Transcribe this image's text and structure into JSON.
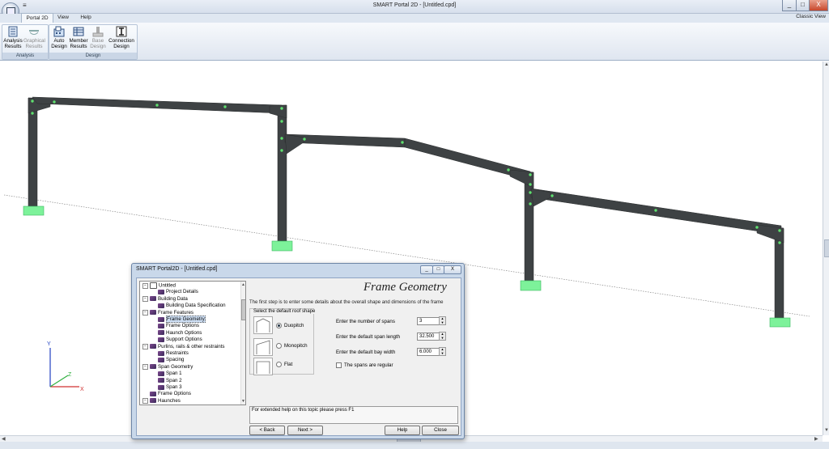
{
  "window": {
    "title": "SMART Portal 2D - [Untitled.cpd]",
    "min": "_",
    "max": "□",
    "close": "X",
    "qa": "≡"
  },
  "menu": {
    "tabs": [
      "Portal 2D",
      "View",
      "Help"
    ],
    "classic_view": "Classic View"
  },
  "ribbon": {
    "groups": [
      {
        "label": "Analysis",
        "buttons": [
          {
            "line1": "Analysis",
            "line2": "Results",
            "icon": "analysis-results-icon",
            "enabled": true
          },
          {
            "line1": "Graphical",
            "line2": "Results",
            "icon": "graphical-results-icon",
            "enabled": false
          }
        ]
      },
      {
        "label": "Design",
        "buttons": [
          {
            "line1": "Auto",
            "line2": "Design",
            "icon": "auto-design-icon",
            "enabled": true
          },
          {
            "line1": "Member",
            "line2": "Results",
            "icon": "member-results-icon",
            "enabled": true
          },
          {
            "line1": "Base",
            "line2": "Design",
            "icon": "base-design-icon",
            "enabled": false
          },
          {
            "line1": "Connection",
            "line2": "Design",
            "icon": "connection-design-icon",
            "enabled": true
          }
        ]
      }
    ]
  },
  "axes": {
    "y": "Y",
    "z": "Z",
    "x": "X"
  },
  "colors": {
    "member": "#3e4244",
    "base": "#7df29a",
    "node": "#5fe06f",
    "accent": "#c9d8ea"
  },
  "dialog": {
    "title": "SMART Portal2D - [Untitled.cpd]",
    "heading": "Frame Geometry",
    "intro": "The first step is to enter some details about the overall shape and dimensions of the frame",
    "roof_group": "Select the default roof shape",
    "roof_options": [
      {
        "label": "Duopitch",
        "checked": true
      },
      {
        "label": "Monopitch",
        "checked": false
      },
      {
        "label": "Flat",
        "checked": false
      }
    ],
    "fields": [
      {
        "label": "Enter the number of spans",
        "value": "3"
      },
      {
        "label": "Enter the default span length",
        "value": "32.500"
      },
      {
        "label": "Enter the default bay width",
        "value": "6.000"
      }
    ],
    "regular_spans": "The spans are regular",
    "help_text": "For extended help on this topic please press F1",
    "buttons": {
      "back": "< Back",
      "next": "Next >",
      "help": "Help",
      "close": "Close"
    },
    "tree": [
      {
        "label": "Untitled",
        "level": 0,
        "toggle": "−",
        "icon": "home",
        "sel": false
      },
      {
        "label": "Project Details",
        "level": 1,
        "toggle": "",
        "icon": "item",
        "sel": false
      },
      {
        "label": "Building Data",
        "level": 0,
        "toggle": "−",
        "icon": "item",
        "sel": false
      },
      {
        "label": "Building Data Specification",
        "level": 1,
        "toggle": "",
        "icon": "item",
        "sel": false
      },
      {
        "label": "Frame Features",
        "level": 0,
        "toggle": "−",
        "icon": "item",
        "sel": false
      },
      {
        "label": "Frame Geometry",
        "level": 1,
        "toggle": "",
        "icon": "item",
        "sel": true
      },
      {
        "label": "Frame Options",
        "level": 1,
        "toggle": "",
        "icon": "item",
        "sel": false
      },
      {
        "label": "Haunch Options",
        "level": 1,
        "toggle": "",
        "icon": "item",
        "sel": false
      },
      {
        "label": "Support Options",
        "level": 1,
        "toggle": "",
        "icon": "item",
        "sel": false
      },
      {
        "label": "Purlins, rails & other restraints",
        "level": 0,
        "toggle": "−",
        "icon": "item",
        "sel": false
      },
      {
        "label": "Restraints",
        "level": 1,
        "toggle": "",
        "icon": "item",
        "sel": false
      },
      {
        "label": "Spacing",
        "level": 1,
        "toggle": "",
        "icon": "item",
        "sel": false
      },
      {
        "label": "Span Geometry",
        "level": 0,
        "toggle": "−",
        "icon": "item",
        "sel": false
      },
      {
        "label": "Span 1",
        "level": 1,
        "toggle": "",
        "icon": "item",
        "sel": false
      },
      {
        "label": "Span 2",
        "level": 1,
        "toggle": "",
        "icon": "item",
        "sel": false
      },
      {
        "label": "Span 3",
        "level": 1,
        "toggle": "",
        "icon": "item",
        "sel": false
      },
      {
        "label": "Frame Options",
        "level": 0,
        "toggle": "",
        "icon": "item",
        "sel": false
      },
      {
        "label": "Haunches",
        "level": 0,
        "toggle": "−",
        "icon": "item",
        "sel": false
      }
    ]
  }
}
